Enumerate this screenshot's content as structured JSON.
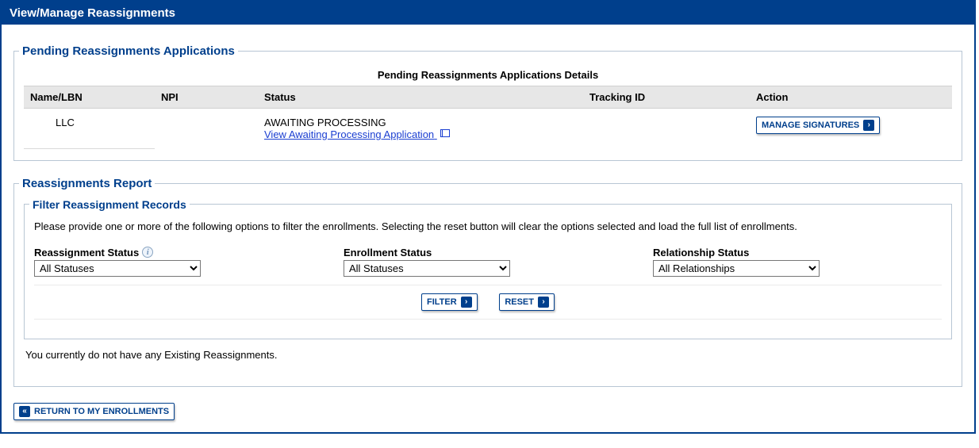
{
  "header": {
    "title": "View/Manage Reassignments"
  },
  "pending": {
    "legend": "Pending Reassignments Applications",
    "caption": "Pending Reassignments Applications Details",
    "columns": {
      "name": "Name/LBN",
      "npi": "NPI",
      "status": "Status",
      "tracking": "Tracking ID",
      "action": "Action"
    },
    "row": {
      "name": "LLC",
      "npi": "",
      "status_text": "AWAITING PROCESSING",
      "status_link": "View Awaiting Processing Application",
      "tracking": "",
      "action_button": "MANAGE SIGNATURES"
    }
  },
  "report": {
    "legend": "Reassignments Report",
    "filter": {
      "legend": "Filter Reassignment Records",
      "intro": "Please provide one or more of the following options to filter the enrollments. Selecting the reset button will clear the options selected and load the full list of enrollments.",
      "reassignment_status": {
        "label": "Reassignment Status",
        "value": "All Statuses"
      },
      "enrollment_status": {
        "label": "Enrollment Status",
        "value": "All Statuses"
      },
      "relationship_status": {
        "label": "Relationship Status",
        "value": "All Relationships"
      },
      "filter_button": "FILTER",
      "reset_button": "RESET"
    },
    "no_records_msg": "You currently do not have any Existing Reassignments."
  },
  "footer": {
    "return_button": "RETURN TO MY ENROLLMENTS"
  }
}
